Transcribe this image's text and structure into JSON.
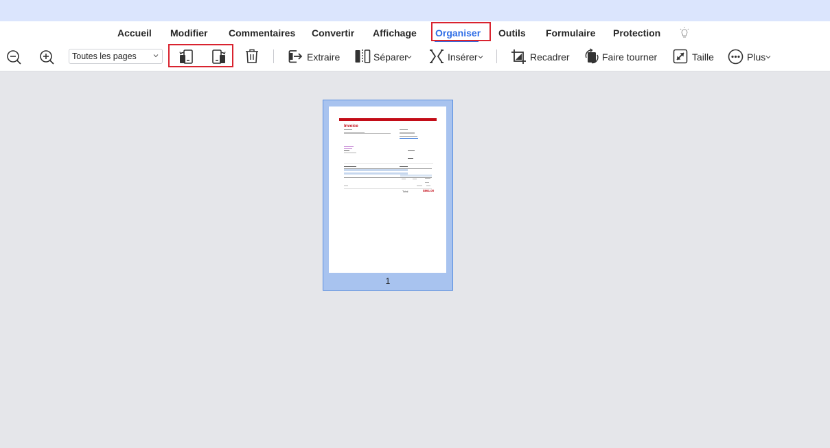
{
  "menu": {
    "items": [
      "Accueil",
      "Modifier",
      "Commentaires",
      "Convertir",
      "Affichage",
      "Organiser",
      "Outils",
      "Formulaire",
      "Protection"
    ],
    "active": "Organiser"
  },
  "toolbar": {
    "pages_select": "Toutes les pages",
    "extraire": "Extraire",
    "separer": "Séparer",
    "inserer": "Insérer",
    "recadrer": "Recadrer",
    "faire_tourner": "Faire tourner",
    "taille": "Taille",
    "plus": "Plus"
  },
  "thumbnail": {
    "page_number": "1",
    "invoice_title": "Invoice",
    "total_label": "Total",
    "total_value": "$861.00"
  },
  "colors": {
    "accent": "#2f6ee6",
    "highlight": "#d9232f",
    "invoice_red": "#c30d18"
  }
}
